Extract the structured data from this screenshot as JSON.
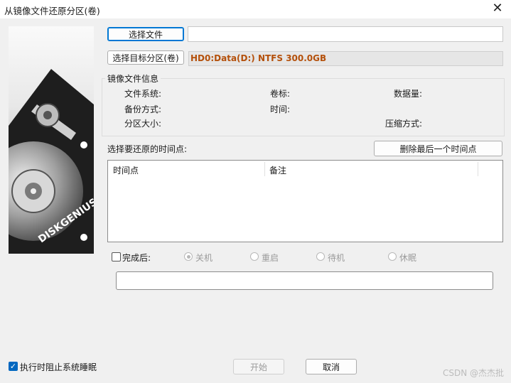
{
  "window": {
    "title": "从镜像文件还原分区(卷)"
  },
  "buttons": {
    "select_file": "选择文件",
    "select_target": "选择目标分区(卷)",
    "delete_last": "删除最后一个时间点",
    "start": "开始",
    "cancel": "取消"
  },
  "target_partition": "HD0:Data(D:) NTFS 300.0GB",
  "image_info": {
    "title": "镜像文件信息",
    "filesystem": "文件系统:",
    "volume_label": "卷标:",
    "data_size": "数据量:",
    "backup_method": "备份方式:",
    "time": "时间:",
    "partition_size": "分区大小:",
    "compression": "压缩方式:"
  },
  "restore_point_label": "选择要还原的时间点:",
  "table": {
    "columns": [
      "时间点",
      "备注"
    ],
    "rows": []
  },
  "after_completion": {
    "label": "完成后:",
    "checked": false,
    "options": [
      "关机",
      "重启",
      "待机",
      "休眠"
    ],
    "selected": "关机"
  },
  "prevent_sleep": {
    "label": "执行时阻止系统睡眠",
    "checked": true
  },
  "logo_text": "DISKGENIUS",
  "watermark": "CSDN @杰杰批"
}
